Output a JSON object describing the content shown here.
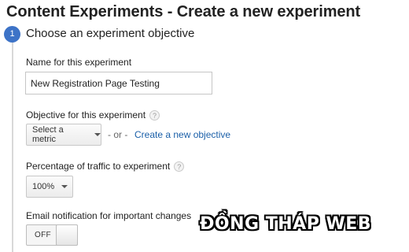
{
  "page": {
    "title": "Content Experiments - Create a new experiment"
  },
  "step": {
    "number": "1",
    "heading": "Choose an experiment objective"
  },
  "name_field": {
    "label": "Name for this experiment",
    "value": "New Registration Page Testing"
  },
  "objective": {
    "label": "Objective for this experiment",
    "help_icon": "?",
    "select_label": "Select a metric",
    "or_text": "- or -",
    "create_link": "Create a new objective"
  },
  "traffic": {
    "label": "Percentage of traffic to experiment",
    "help_icon": "?",
    "selected_value": "100%"
  },
  "email": {
    "label": "Email notification for important changes",
    "toggle_state": "OFF"
  },
  "watermark": {
    "text": "ĐỒNG THÁP WEB"
  },
  "colors": {
    "accent": "#3d73c7",
    "link": "#1a5fa8"
  },
  "icons": {
    "help": "help-circle-icon",
    "dropdown": "caret-down-icon"
  }
}
